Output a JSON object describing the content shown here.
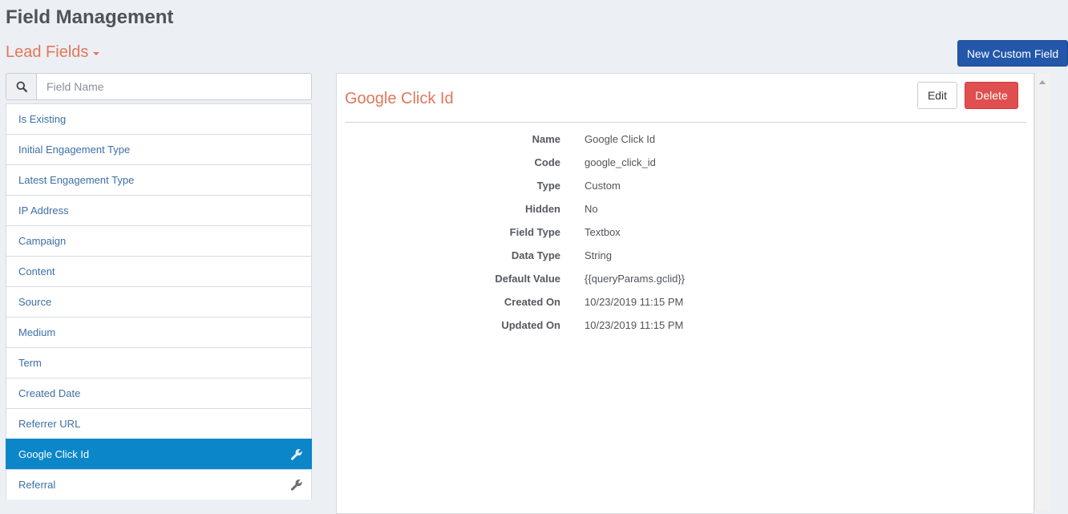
{
  "page": {
    "title": "Field Management",
    "section": "Lead Fields",
    "new_button": "New Custom Field"
  },
  "search": {
    "placeholder": "Field Name",
    "value": ""
  },
  "fields": [
    {
      "label": "Is Existing"
    },
    {
      "label": "Initial Engagement Type"
    },
    {
      "label": "Latest Engagement Type"
    },
    {
      "label": "IP Address"
    },
    {
      "label": "Campaign"
    },
    {
      "label": "Content"
    },
    {
      "label": "Source"
    },
    {
      "label": "Medium"
    },
    {
      "label": "Term"
    },
    {
      "label": "Created Date"
    },
    {
      "label": "Referrer URL"
    },
    {
      "label": "Google Click Id",
      "active": true,
      "icon": "wrench-icon"
    },
    {
      "label": "Referral",
      "icon": "wrench-icon"
    }
  ],
  "detail": {
    "title": "Google Click Id",
    "edit_label": "Edit",
    "delete_label": "Delete",
    "properties": [
      {
        "label": "Name",
        "value": "Google Click Id"
      },
      {
        "label": "Code",
        "value": "google_click_id"
      },
      {
        "label": "Type",
        "value": "Custom"
      },
      {
        "label": "Hidden",
        "value": "No"
      },
      {
        "label": "Field Type",
        "value": "Textbox"
      },
      {
        "label": "Data Type",
        "value": "String"
      },
      {
        "label": "Default Value",
        "value": "{{queryParams.gclid}}"
      },
      {
        "label": "Created On",
        "value": "10/23/2019 11:15 PM"
      },
      {
        "label": "Updated On",
        "value": "10/23/2019 11:15 PM"
      }
    ]
  },
  "colors": {
    "accent": "#e2775a",
    "primary_button": "#2357a9",
    "active_item": "#0b86c9",
    "delete_button": "#df4f4f",
    "link": "#3d6fa8"
  }
}
